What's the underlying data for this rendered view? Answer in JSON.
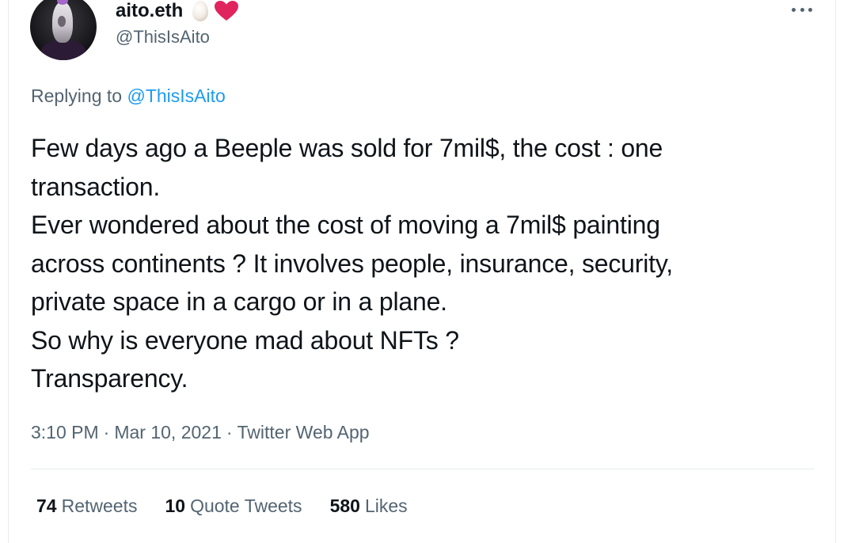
{
  "author": {
    "display_name": "aito.eth",
    "handle": "@ThisIsAito",
    "badges": [
      "egg-icon",
      "heart-icon"
    ]
  },
  "reply": {
    "prefix": "Replying to",
    "mention": "@ThisIsAito"
  },
  "tweet": {
    "text": "Few days ago a Beeple was sold for 7mil$, the cost : one\ntransaction.\nEver wondered about the cost of moving a 7mil$ painting\nacross continents ? It involves people, insurance, security,\nprivate space in a cargo or in a plane.\nSo why is everyone mad about NFTs ?\nTransparency."
  },
  "meta": {
    "time": "3:10 PM",
    "separator": "·",
    "date": "Mar 10, 2021",
    "source": "Twitter Web App"
  },
  "stats": [
    {
      "count": "74",
      "label": "Retweets"
    },
    {
      "count": "10",
      "label": "Quote Tweets"
    },
    {
      "count": "580",
      "label": "Likes"
    }
  ],
  "colors": {
    "text": "#0f1419",
    "secondary": "#536471",
    "link": "#1d9bf0",
    "heart": "#e0245e"
  }
}
